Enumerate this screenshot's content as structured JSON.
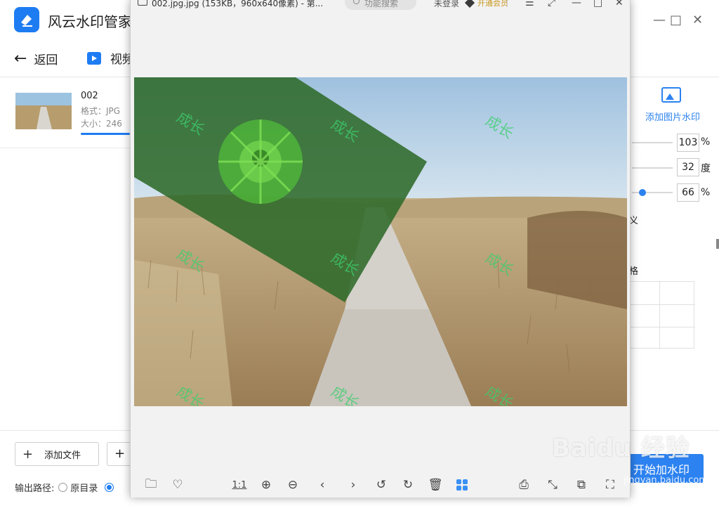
{
  "app": {
    "title": "风云水印管家",
    "back_label": "返回",
    "video_tab_label": "视频",
    "file": {
      "name": "002",
      "format": "格式：JPG",
      "size": "大小：246"
    },
    "add_file_label": "添加文件",
    "add_more_label": "+",
    "output_path_label": "输出路径:",
    "output_original_label": "原目录",
    "start_button_label": "开始加水印",
    "win_controls": [
      "—",
      "□",
      "✕"
    ]
  },
  "right_panel": {
    "add_image_watermark_label": "添加图片水印",
    "size_value": "103",
    "size_unit": "%",
    "rotate_value": "32",
    "rotate_unit": "度",
    "opacity_value": "66",
    "opacity_unit": "%",
    "cut_char_1": "义",
    "cut_char_2": "格"
  },
  "viewer": {
    "title": "002.jpg.jpg (153KB，960x640像素) - 第...",
    "search_placeholder": "功能搜索",
    "login_label": "未登录",
    "vip_label": "开通会员",
    "watermark_text": "成长",
    "toolbar": {
      "one_to_one_label": "1:1"
    }
  },
  "overlay_watermark": {
    "brand": "Baidu 经验",
    "url": "jingyan.baidu.com"
  },
  "colors": {
    "accent": "#2c82f0",
    "watermark_text": "#3ccd6e"
  }
}
